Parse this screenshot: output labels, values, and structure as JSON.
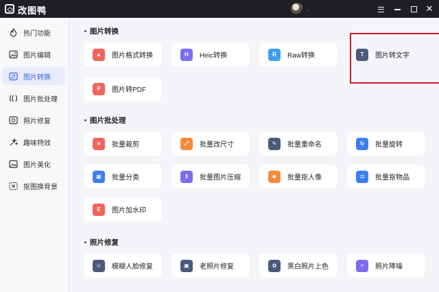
{
  "app": {
    "title": "改图鸭",
    "user_name": "."
  },
  "window_controls": [
    "menu",
    "minimize",
    "maximize",
    "close"
  ],
  "sidebar": {
    "items": [
      {
        "label": "热门功能",
        "icon": "hot-icon",
        "active": false
      },
      {
        "label": "图片编辑",
        "icon": "image-edit-icon",
        "active": false
      },
      {
        "label": "图片转换",
        "icon": "convert-icon",
        "active": true
      },
      {
        "label": "图片批处理",
        "icon": "batch-icon",
        "active": false
      },
      {
        "label": "照片修复",
        "icon": "repair-icon",
        "active": false
      },
      {
        "label": "趣味特效",
        "icon": "effects-icon",
        "active": false
      },
      {
        "label": "图片美化",
        "icon": "beautify-icon",
        "active": false
      },
      {
        "label": "抠图换背景",
        "icon": "cutout-icon",
        "active": false
      }
    ]
  },
  "sections": [
    {
      "title": "图片转换",
      "cards": [
        {
          "label": "图片格式转换",
          "icon": "format-convert-icon",
          "color": "#f0655b",
          "glyph": "▲"
        },
        {
          "label": "Heic转换",
          "icon": "heic-icon",
          "color": "#7c6df0",
          "glyph": "H"
        },
        {
          "label": "Raw转换",
          "icon": "raw-icon",
          "color": "#3fa0f0",
          "glyph": "R"
        },
        {
          "label": "图片转文字",
          "icon": "image-to-text-icon",
          "color": "#4a5a7a",
          "glyph": "T"
        },
        {
          "label": "图片转PDF",
          "icon": "image-to-pdf-icon",
          "color": "#f0655b",
          "glyph": "P"
        }
      ]
    },
    {
      "title": "图片批处理",
      "cards": [
        {
          "label": "批量裁剪",
          "icon": "batch-crop-icon",
          "color": "#f0655b",
          "glyph": "⌗"
        },
        {
          "label": "批量改尺寸",
          "icon": "batch-resize-icon",
          "color": "#f58a3c",
          "glyph": "⤢"
        },
        {
          "label": "批量重命名",
          "icon": "batch-rename-icon",
          "color": "#4a5a7a",
          "glyph": "✎"
        },
        {
          "label": "批量旋转",
          "icon": "batch-rotate-icon",
          "color": "#3f7ef0",
          "glyph": "↻"
        },
        {
          "label": "批量分类",
          "icon": "batch-classify-icon",
          "color": "#3f7ef0",
          "glyph": "▦"
        },
        {
          "label": "批量图片压缩",
          "icon": "batch-compress-icon",
          "color": "#7c6df0",
          "glyph": "⇕"
        },
        {
          "label": "批量抠人像",
          "icon": "batch-portrait-icon",
          "color": "#f58a3c",
          "glyph": "☻"
        },
        {
          "label": "批量抠物品",
          "icon": "batch-object-icon",
          "color": "#3f7ef0",
          "glyph": "◘"
        },
        {
          "label": "图片加水印",
          "icon": "watermark-icon",
          "color": "#f0655b",
          "glyph": "E"
        }
      ]
    },
    {
      "title": "照片修复",
      "cards": [
        {
          "label": "模糊人脸修复",
          "icon": "face-repair-icon",
          "color": "#4a5a7a",
          "glyph": "☺"
        },
        {
          "label": "老照片修复",
          "icon": "old-photo-icon",
          "color": "#4a5a7a",
          "glyph": "▣"
        },
        {
          "label": "黑白照片上色",
          "icon": "colorize-icon",
          "color": "#4a5a7a",
          "glyph": "✿"
        },
        {
          "label": "照片降噪",
          "icon": "denoise-icon",
          "color": "#7c6df0",
          "glyph": "✧"
        }
      ]
    }
  ]
}
